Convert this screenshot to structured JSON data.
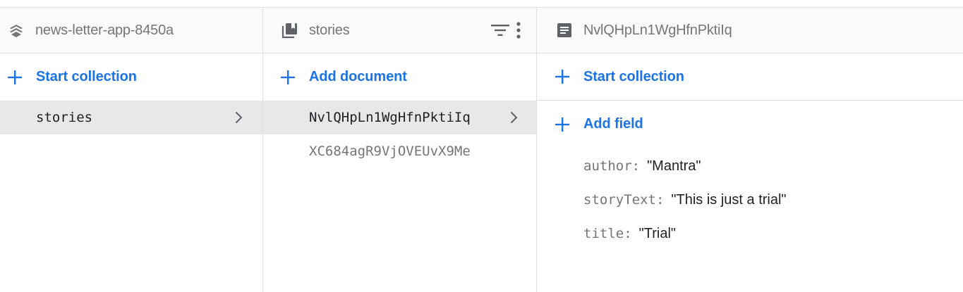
{
  "panel_root": {
    "title": "news-letter-app-8450a",
    "title_icon": "firestore-stack-icon",
    "start_collection_label": "Start collection",
    "collections": [
      {
        "label": "stories",
        "selected": true
      }
    ]
  },
  "panel_collection": {
    "title": "stories",
    "title_icon": "collection-icon",
    "filter_icon": "filter-icon",
    "more_icon": "more-vert-icon",
    "add_document_label": "Add document",
    "documents": [
      {
        "label": "NvlQHpLn1WgHfnPktiIq",
        "selected": true
      },
      {
        "label": "XC684agR9VjOVEUvX9Me",
        "selected": false
      }
    ]
  },
  "panel_document": {
    "title": "NvlQHpLn1WgHfnPktiIq",
    "title_icon": "document-icon",
    "start_collection_label": "Start collection",
    "add_field_label": "Add field",
    "fields": [
      {
        "key": "author:",
        "value": "\"Mantra\""
      },
      {
        "key": "storyText:",
        "value": "\"This is just a trial\""
      },
      {
        "key": "title:",
        "value": "\"Trial\""
      }
    ]
  },
  "colors": {
    "accent": "#1a73e8",
    "muted_text": "#757575",
    "selected_row": "#e8e8e8",
    "divider": "#e0e0e0",
    "header_bg": "#fafafa"
  }
}
